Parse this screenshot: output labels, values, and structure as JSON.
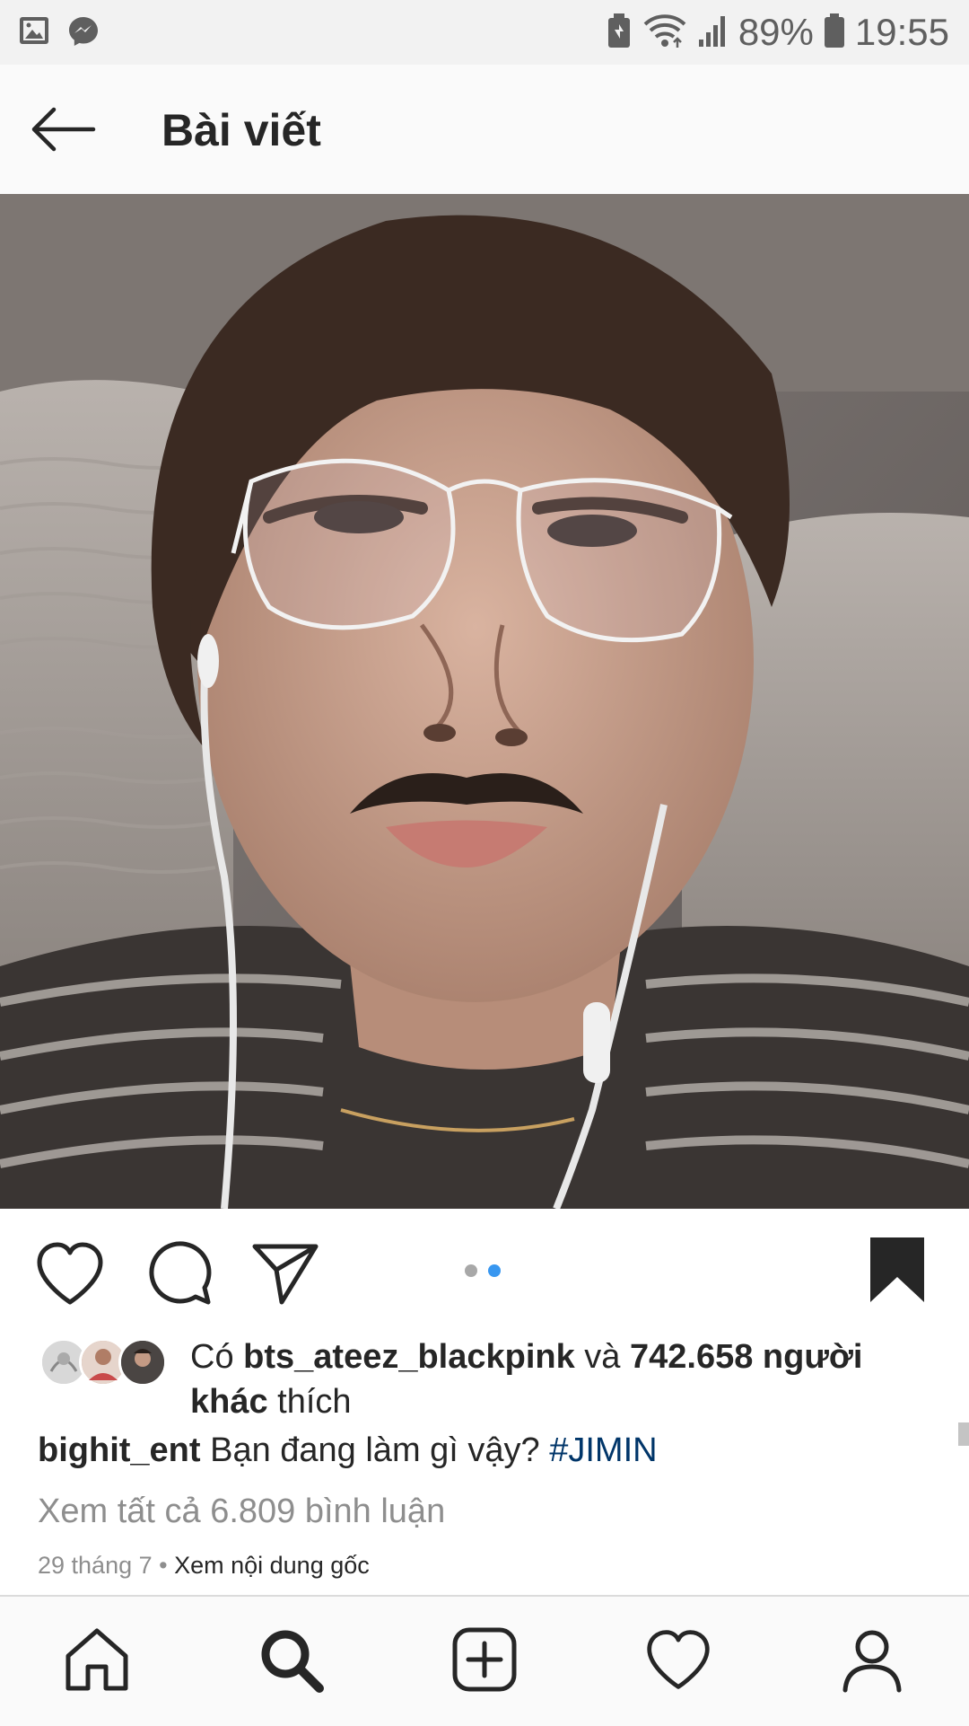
{
  "status_bar": {
    "battery": "89%",
    "time": "19:55"
  },
  "header": {
    "title": "Bài viết"
  },
  "post": {
    "carousel_pages": 2,
    "carousel_current": 2,
    "likes": {
      "prefix": "Có ",
      "user": "bts_ateez_blackpink",
      "middle": " và ",
      "count": "742.658 người khác",
      "suffix": " thích"
    },
    "caption": {
      "username": "bighit_ent",
      "text": " Bạn đang làm gì vậy? ",
      "hashtag": "#JIMIN"
    },
    "view_comments": "Xem tất cả 6.809 bình luận",
    "date": "29 tháng 7",
    "separator": " • ",
    "see_original": "Xem nội dung gốc"
  },
  "colors": {
    "accent_blue": "#3897f0",
    "hashtag": "#003569",
    "muted": "#8e8e8e"
  },
  "icons": {
    "status_left": [
      "gallery-icon",
      "messenger-icon"
    ],
    "status_right": [
      "battery-saver-icon",
      "wifi-icon",
      "signal-icon",
      "battery-icon"
    ],
    "actions": [
      "heart-icon",
      "comment-icon",
      "share-icon",
      "bookmark-icon"
    ],
    "nav": [
      "home-icon",
      "search-icon",
      "add-icon",
      "activity-icon",
      "profile-icon"
    ]
  }
}
